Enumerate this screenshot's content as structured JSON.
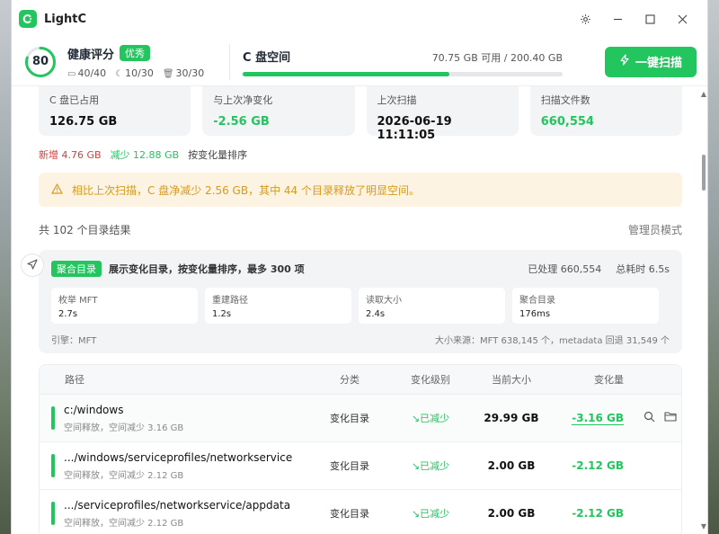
{
  "app": {
    "title": "LightC"
  },
  "window_controls": {
    "settings": "settings",
    "minimize": "minimize",
    "maximize": "maximize",
    "close": "close"
  },
  "header": {
    "score": "80",
    "score_progress": 0.8,
    "health_title": "健康评分",
    "health_badge": "优秀",
    "metrics": [
      {
        "icon": "drive-icon",
        "value": "40/40"
      },
      {
        "icon": "moon-icon",
        "value": "10/30"
      },
      {
        "icon": "trash-icon",
        "value": "30/30"
      }
    ],
    "disk_title": "C 盘空间",
    "disk_free": "70.75 GB 可用 / 200.40 GB",
    "disk_used_fraction": 0.647,
    "scan_button": "一键扫描"
  },
  "stats": [
    {
      "label": "C 盘已占用",
      "value": "126.75 GB",
      "color": "#111111"
    },
    {
      "label": "与上次净变化",
      "value": "-2.56 GB",
      "color": "#22c55e"
    },
    {
      "label": "上次扫描",
      "value": "2026-06-19 11:11:05",
      "color": "#111111"
    },
    {
      "label": "扫描文件数",
      "value": "660,554",
      "color": "#22c55e"
    }
  ],
  "change_summary": {
    "increase": "新增 4.76 GB",
    "decrease": "减少 12.88 GB",
    "sort": "按变化量排序"
  },
  "alert": {
    "text": "相比上次扫描，C 盘净减少 2.56 GB，其中 44 个目录释放了明显空间。"
  },
  "results": {
    "count": "共 102 个目录结果",
    "mode": "管理员模式"
  },
  "merged": {
    "badge": "聚合目录",
    "description": "展示变化目录，按变化量排序，最多 300 项",
    "processed": "已处理 660,554",
    "total_time": "总耗时 6.5s",
    "timings": [
      {
        "label": "枚举 MFT",
        "value": "2.7s"
      },
      {
        "label": "重建路径",
        "value": "1.2s"
      },
      {
        "label": "读取大小",
        "value": "2.4s"
      },
      {
        "label": "聚合目录",
        "value": "176ms"
      }
    ],
    "engine": "引擎：MFT",
    "source": "大小来源：MFT 638,145 个，metadata 回退 31,549 个"
  },
  "table": {
    "headers": {
      "path": "路径",
      "category": "分类",
      "level": "变化级别",
      "size": "当前大小",
      "change": "变化量"
    },
    "rows": [
      {
        "path": "c:/windows",
        "sub": "空间释放，空间减少 3.16 GB",
        "category": "变化目录",
        "level": "已减少",
        "size": "29.99 GB",
        "change": "-3.16 GB"
      },
      {
        "path": ".../windows/serviceprofiles/networkservice",
        "sub": "空间释放，空间减少 2.12 GB",
        "category": "变化目录",
        "level": "已减少",
        "size": "2.00 GB",
        "change": "-2.12 GB"
      },
      {
        "path": ".../serviceprofiles/networkservice/appdata",
        "sub": "空间释放，空间减少 2.12 GB",
        "category": "变化目录",
        "level": "已减少",
        "size": "2.00 GB",
        "change": "-2.12 GB"
      }
    ]
  },
  "colors": {
    "accent": "#22c55e",
    "increase": "#dc3b3b",
    "warning_bg": "#fdf3e2",
    "warning_text": "#d99a16"
  }
}
